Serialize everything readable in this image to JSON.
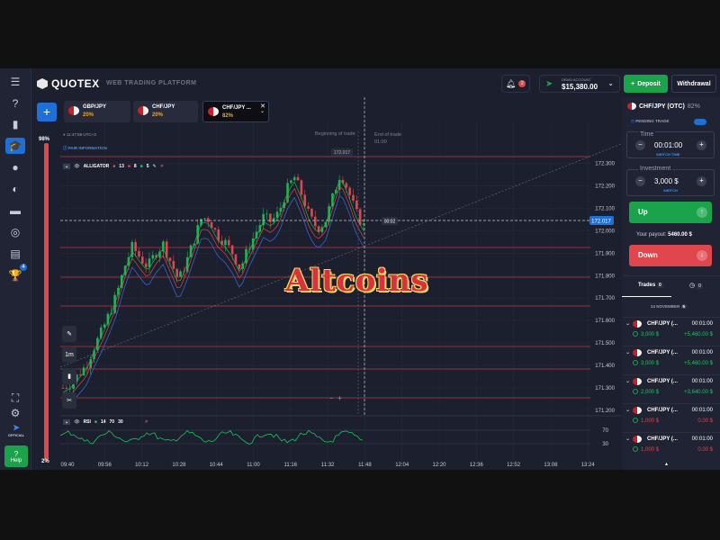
{
  "header": {
    "logo": "QUOTEX",
    "subtitle": "WEB TRADING PLATFORM",
    "notif_count": "2",
    "account_label": "DEMO ACCOUNT",
    "balance": "$15,380.00",
    "deposit": "Deposit",
    "withdrawal": "Withdrawal"
  },
  "tabs": [
    {
      "name": "GBP/JPY",
      "pct": "20%"
    },
    {
      "name": "CHF/JPY",
      "pct": "20%"
    },
    {
      "name": "CHF/JPY ...",
      "pct": "82%"
    }
  ],
  "sidebar": {
    "badge": "4",
    "official": "OFFICIAL",
    "help": "Help",
    "bar_top": "98%",
    "bar_bottom": "2%"
  },
  "chart_info": {
    "clock": "11:47:58 UTC+3",
    "pair_info": "PAIR INFORMATION",
    "indicator": "ALLIGATOR",
    "alligator_params": [
      "13",
      "8",
      "5"
    ],
    "beginning_label": "Beginning of trade",
    "end_label": "End of trade",
    "end_time": "01:00",
    "current_price": "172.017",
    "hover_price": "172.017",
    "countdown": "00:02",
    "rsi_label": "RSI",
    "rsi_params": [
      "14",
      "70",
      "30"
    ],
    "rsi_levels": [
      "70",
      "30"
    ],
    "zoom": "1m",
    "overlay_text": "Altcoins"
  },
  "chart_data": {
    "type": "candlestick",
    "x_ticks": [
      "09:40",
      "09:56",
      "10:12",
      "10:28",
      "10:44",
      "11:00",
      "11:16",
      "11:32",
      "11:48",
      "12:04",
      "12:20",
      "12:36",
      "12:52",
      "13:08",
      "13:24"
    ],
    "y_ticks": [
      "172.300",
      "172.200",
      "172.100",
      "172.000",
      "171.900",
      "171.800",
      "171.700",
      "171.600",
      "171.500",
      "171.400",
      "171.300",
      "171.200"
    ],
    "ylim": [
      171.18,
      172.33
    ],
    "price_path": [
      171.3,
      171.32,
      171.36,
      171.4,
      171.48,
      171.55,
      171.63,
      171.72,
      171.84,
      171.93,
      171.88,
      171.84,
      171.9,
      171.94,
      171.86,
      171.78,
      171.86,
      171.96,
      172.06,
      172.05,
      171.98,
      171.95,
      171.9,
      171.83,
      171.92,
      171.99,
      172.06,
      172.04,
      172.08,
      172.18,
      172.24,
      172.16,
      172.06,
      172.01,
      172.04,
      172.15,
      172.26,
      172.18,
      172.08,
      172.02
    ]
  },
  "panel": {
    "asset": "CHF/JPY (OTC)",
    "asset_pct": "82%",
    "pending": "PENDING TRADE",
    "time_label": "Time",
    "time_value": "00:01:00",
    "switch_time": "SWITCH TIME",
    "investment_label": "Investment",
    "investment_value": "3,000 $",
    "switch": "SWITCH",
    "up": "Up",
    "payout_label": "Your payout:",
    "payout_value": "5460.00 $",
    "down": "Down"
  },
  "trades": {
    "tab_label": "Trades",
    "tab_count": "0",
    "clock_count": "0",
    "date": "24 NOVEMBER",
    "date_count": "5",
    "rows": [
      {
        "asset": "CHF/JPY (...",
        "time": "00:01:00",
        "amount": "3,000 $",
        "profit": "+5,460.00 $",
        "dir": "up"
      },
      {
        "asset": "CHF/JPY (...",
        "time": "00:01:00",
        "amount": "3,000 $",
        "profit": "+5,460.00 $",
        "dir": "up"
      },
      {
        "asset": "CHF/JPY (...",
        "time": "00:01:00",
        "amount": "2,000 $",
        "profit": "+3,640.00 $",
        "dir": "up"
      },
      {
        "asset": "CHF/JPY (...",
        "time": "00:01:00",
        "amount": "1,000 $",
        "profit": "0.00 $",
        "dir": "down"
      },
      {
        "asset": "CHF/JPY (...",
        "time": "00:01:00",
        "amount": "1,000 $",
        "profit": "0.00 $",
        "dir": "down"
      }
    ]
  }
}
